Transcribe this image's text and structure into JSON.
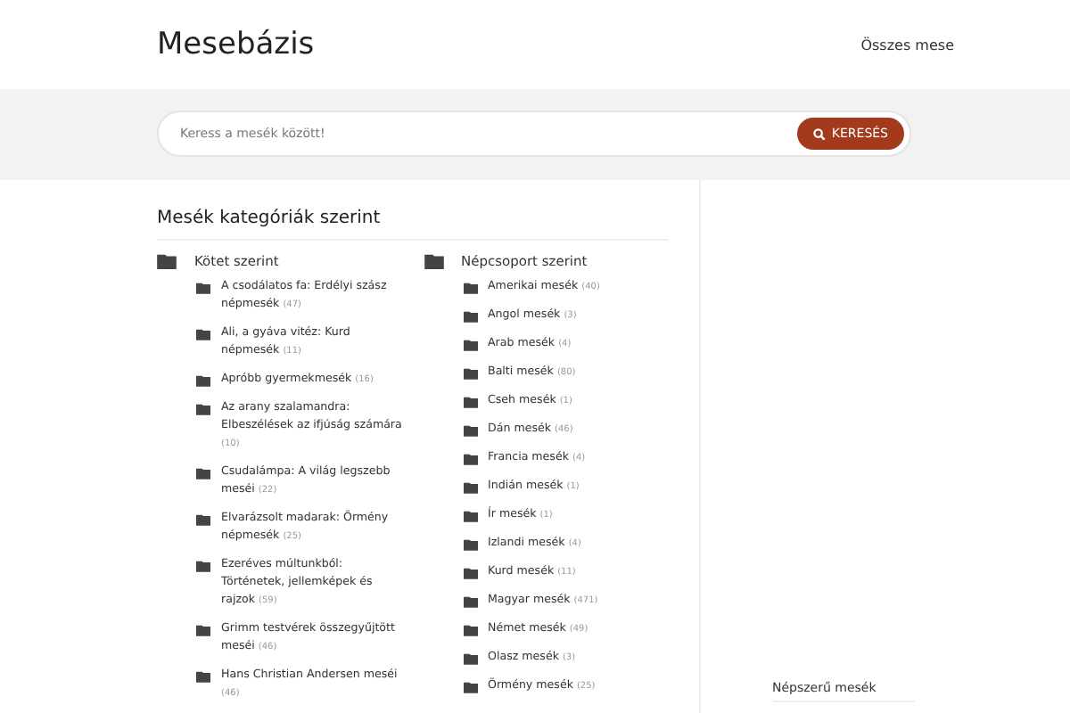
{
  "header": {
    "logo": "Mesebázis",
    "nav": [
      "Összes mese"
    ]
  },
  "search": {
    "placeholder": "Keress a mesék között!",
    "button": "KERESÉS"
  },
  "main": {
    "title": "Mesék kategóriák szerint",
    "groups": [
      {
        "label": "Kötet szerint",
        "items": [
          {
            "label": "A csodálatos fa: Erdélyi szász népmesék",
            "count": "(47)"
          },
          {
            "label": "Ali, a gyáva vitéz: Kurd népmesék",
            "count": "(11)"
          },
          {
            "label": "Apróbb gyermekmesék",
            "count": "(16)"
          },
          {
            "label": "Az arany szalamandra: Elbeszélések az ifjúság számára",
            "count": "(10)"
          },
          {
            "label": "Csudalámpa: A világ legszebb meséi",
            "count": "(22)"
          },
          {
            "label": "Elvarázsolt madarak: Örmény népmesék",
            "count": "(25)"
          },
          {
            "label": "Ezeréves múltunkból: Történetek, jellemképek és rajzok",
            "count": "(59)"
          },
          {
            "label": "Grimm testvérek összegyűjtött meséi",
            "count": "(46)"
          },
          {
            "label": "Hans Christian Andersen meséi",
            "count": "(46)"
          }
        ]
      },
      {
        "label": "Népcsoport szerint",
        "items": [
          {
            "label": "Amerikai mesék",
            "count": "(40)"
          },
          {
            "label": "Angol mesék",
            "count": "(3)"
          },
          {
            "label": "Arab mesék",
            "count": "(4)"
          },
          {
            "label": "Balti mesék",
            "count": "(80)"
          },
          {
            "label": "Cseh mesék",
            "count": "(1)"
          },
          {
            "label": "Dán mesék",
            "count": "(46)"
          },
          {
            "label": "Francia mesék",
            "count": "(4)"
          },
          {
            "label": "Indián mesék",
            "count": "(1)"
          },
          {
            "label": "Ír mesék",
            "count": "(1)"
          },
          {
            "label": "Izlandi mesék",
            "count": "(4)"
          },
          {
            "label": "Kurd mesék",
            "count": "(11)"
          },
          {
            "label": "Magyar mesék",
            "count": "(471)"
          },
          {
            "label": "Német mesék",
            "count": "(49)"
          },
          {
            "label": "Olasz mesék",
            "count": "(3)"
          },
          {
            "label": "Örmény mesék",
            "count": "(25)"
          }
        ]
      }
    ]
  },
  "sidebar": {
    "title": "Népszerű mesék"
  }
}
